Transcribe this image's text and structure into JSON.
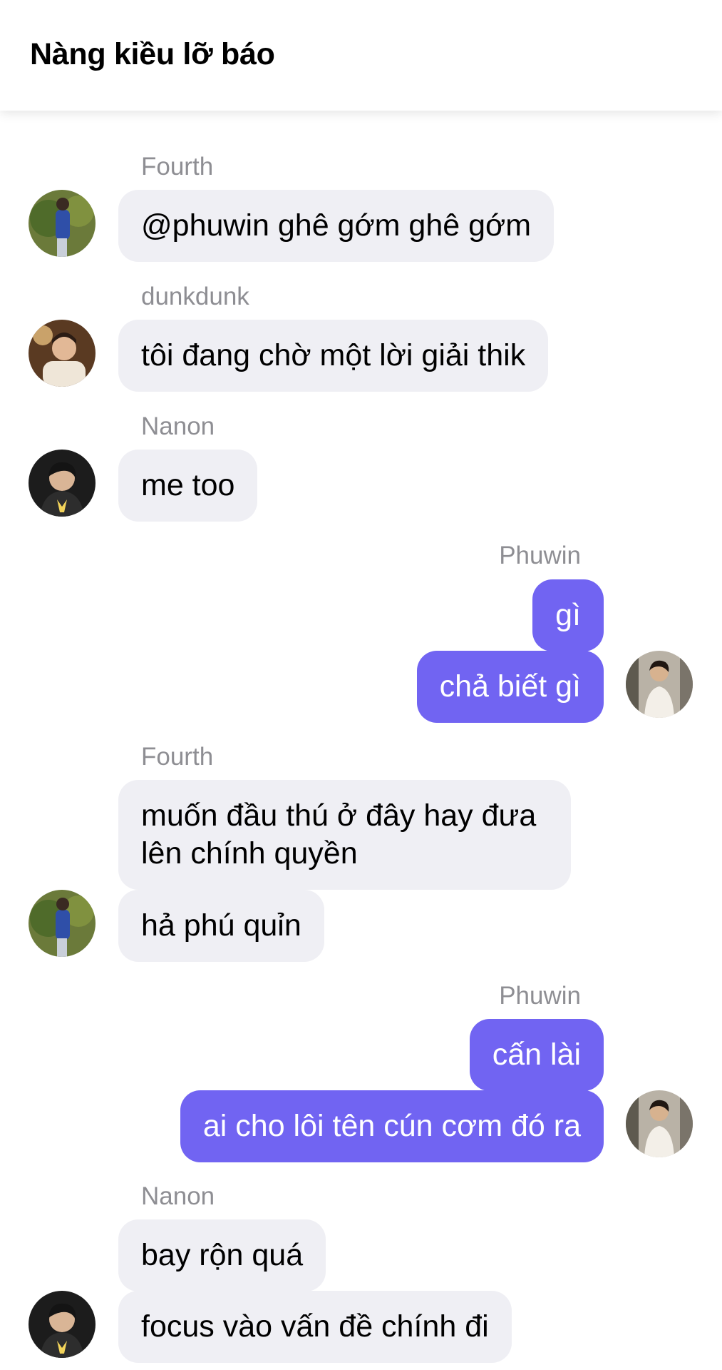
{
  "header": {
    "title": "Nàng kiều lỡ báo"
  },
  "messages": [
    {
      "sender": "Fourth",
      "text": "@phuwin ghê gớm ghê gớm",
      "direction": "incoming",
      "avatar": "fourth"
    },
    {
      "sender": "dunkdunk",
      "text": "tôi đang chờ một lời giải thik",
      "direction": "incoming",
      "avatar": "dunk"
    },
    {
      "sender": "Nanon",
      "text": "me too",
      "direction": "incoming",
      "avatar": "nanon"
    },
    {
      "sender": "Phuwin",
      "text": "gì",
      "direction": "outgoing"
    },
    {
      "text": "chả biết gì",
      "direction": "outgoing",
      "avatar": "phuwin"
    },
    {
      "sender": "Fourth",
      "text": "muốn đầu thú ở đây hay đưa lên chính quyền",
      "direction": "incoming"
    },
    {
      "text": "hả phú quỉn",
      "direction": "incoming",
      "avatar": "fourth"
    },
    {
      "sender": "Phuwin",
      "text": "cấn lài",
      "direction": "outgoing"
    },
    {
      "text": "ai cho lôi tên cún cơm đó ra",
      "direction": "outgoing",
      "avatar": "phuwin"
    },
    {
      "sender": "Nanon",
      "text": "bay rộn quá",
      "direction": "incoming"
    },
    {
      "text": "focus vào vấn đề chính đi",
      "direction": "incoming",
      "avatar": "nanon"
    }
  ],
  "colors": {
    "outgoing_bubble": "#7164f2",
    "incoming_bubble": "#efeff4",
    "sender_label": "#8e8e93"
  }
}
